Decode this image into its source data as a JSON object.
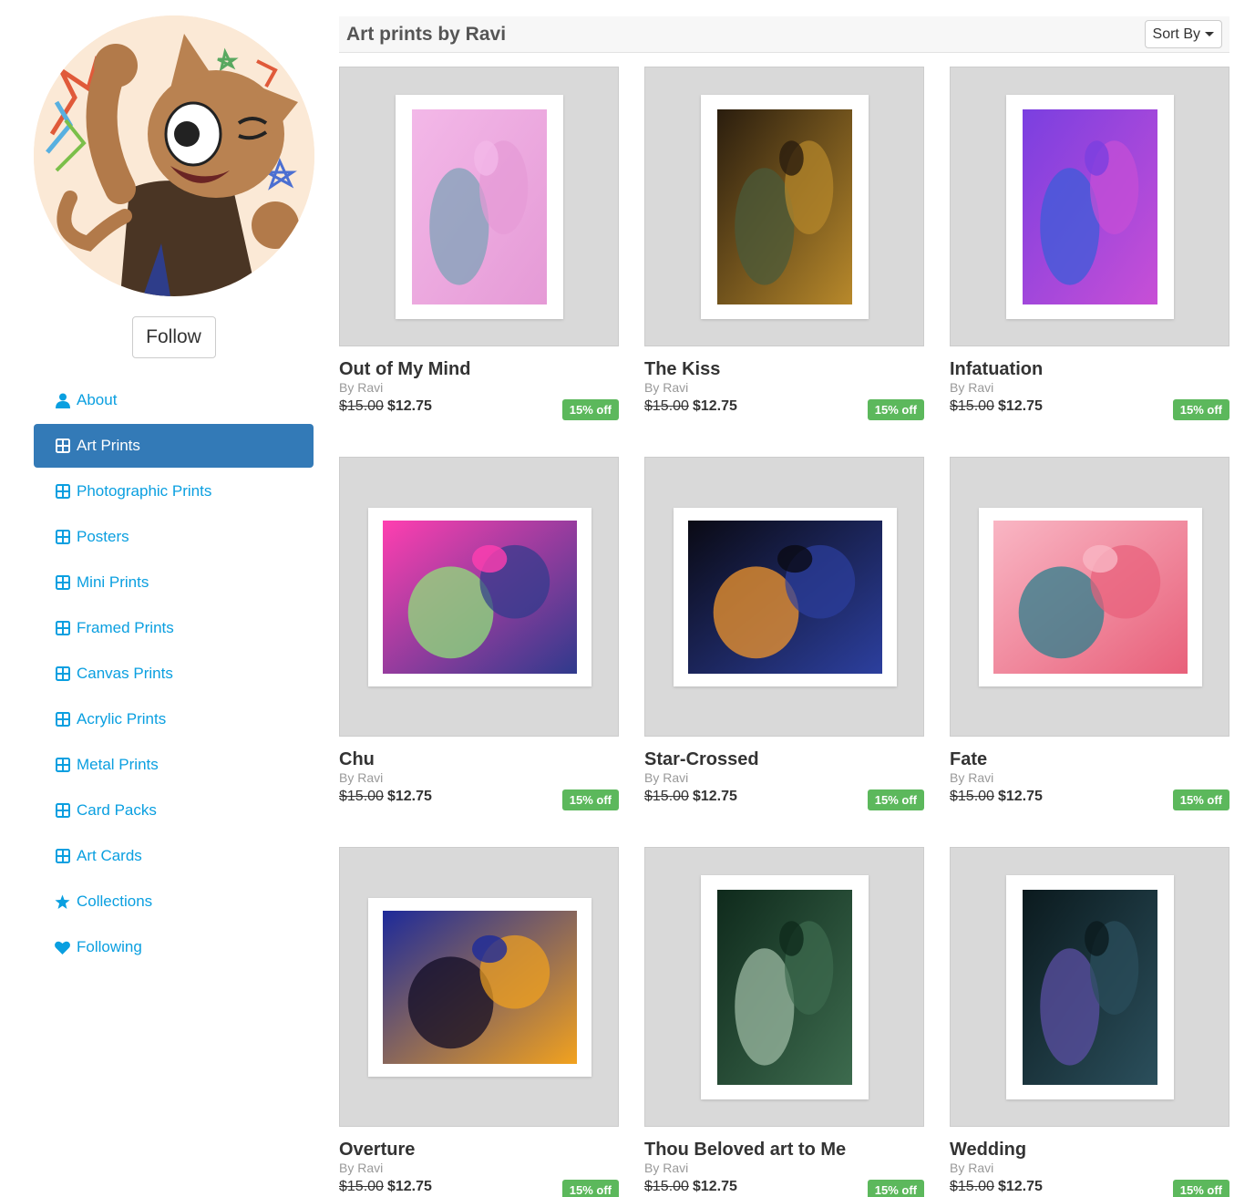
{
  "follow_label": "Follow",
  "nav": [
    {
      "label": "About",
      "icon": "user-icon"
    },
    {
      "label": "Art Prints",
      "icon": "grid-icon",
      "active": true
    },
    {
      "label": "Photographic Prints",
      "icon": "grid-icon"
    },
    {
      "label": "Posters",
      "icon": "grid-icon"
    },
    {
      "label": "Mini Prints",
      "icon": "grid-icon"
    },
    {
      "label": "Framed Prints",
      "icon": "grid-icon"
    },
    {
      "label": "Canvas Prints",
      "icon": "grid-icon"
    },
    {
      "label": "Acrylic Prints",
      "icon": "grid-icon"
    },
    {
      "label": "Metal Prints",
      "icon": "grid-icon"
    },
    {
      "label": "Card Packs",
      "icon": "grid-icon"
    },
    {
      "label": "Art Cards",
      "icon": "grid-icon"
    },
    {
      "label": "Collections",
      "icon": "star-icon"
    },
    {
      "label": "Following",
      "icon": "heart-icon"
    }
  ],
  "header": {
    "title": "Art prints by Ravi",
    "sort_label": "Sort By"
  },
  "products": [
    {
      "title": "Out of My Mind",
      "by": "By Ravi",
      "old_price": "$15.00",
      "price": "$12.75",
      "badge": "15% off",
      "orientation": "portrait",
      "palette": [
        "#f3b8e8",
        "#e59ad6",
        "#7fa3b8"
      ]
    },
    {
      "title": "The Kiss",
      "by": "By Ravi",
      "old_price": "$15.00",
      "price": "$12.75",
      "badge": "15% off",
      "orientation": "portrait",
      "palette": [
        "#2a1d0e",
        "#b8892b",
        "#4a5a3a"
      ]
    },
    {
      "title": "Infatuation",
      "by": "By Ravi",
      "old_price": "$15.00",
      "price": "$12.75",
      "badge": "15% off",
      "orientation": "portrait",
      "palette": [
        "#7a3fe0",
        "#c84fd6",
        "#3c5cd8"
      ]
    },
    {
      "title": "Chu",
      "by": "By Ravi",
      "old_price": "$15.00",
      "price": "$12.75",
      "badge": "15% off",
      "orientation": "landscape",
      "palette": [
        "#ff3fb0",
        "#2f3a8c",
        "#8fe07a"
      ]
    },
    {
      "title": "Star-Crossed",
      "by": "By Ravi",
      "old_price": "$15.00",
      "price": "$12.75",
      "badge": "15% off",
      "orientation": "landscape",
      "palette": [
        "#0a0a14",
        "#2c3f9e",
        "#f0962e"
      ]
    },
    {
      "title": "Fate",
      "by": "By Ravi",
      "old_price": "$15.00",
      "price": "$12.75",
      "badge": "15% off",
      "orientation": "landscape",
      "palette": [
        "#f9b6c4",
        "#e8607a",
        "#2d7f8c"
      ]
    },
    {
      "title": "Overture",
      "by": "By Ravi",
      "old_price": "$15.00",
      "price": "$12.75",
      "badge": "15% off",
      "orientation": "landscape",
      "palette": [
        "#1d2a9a",
        "#f2a21e",
        "#120c24"
      ]
    },
    {
      "title": "Thou Beloved art to Me",
      "by": "By Ravi",
      "old_price": "$15.00",
      "price": "$12.75",
      "badge": "15% off",
      "orientation": "portrait",
      "palette": [
        "#0f2a1c",
        "#3d6b4e",
        "#9bb8a2"
      ]
    },
    {
      "title": "Wedding",
      "by": "By Ravi",
      "old_price": "$15.00",
      "price": "$12.75",
      "badge": "15% off",
      "orientation": "portrait",
      "palette": [
        "#0b1a1e",
        "#2b4f5c",
        "#5b4fa3"
      ]
    }
  ],
  "colors": {
    "link": "#0a9fe0",
    "active_bg": "#337ab7",
    "badge": "#5cb85c",
    "thumb_bg": "#d9d9d9"
  }
}
